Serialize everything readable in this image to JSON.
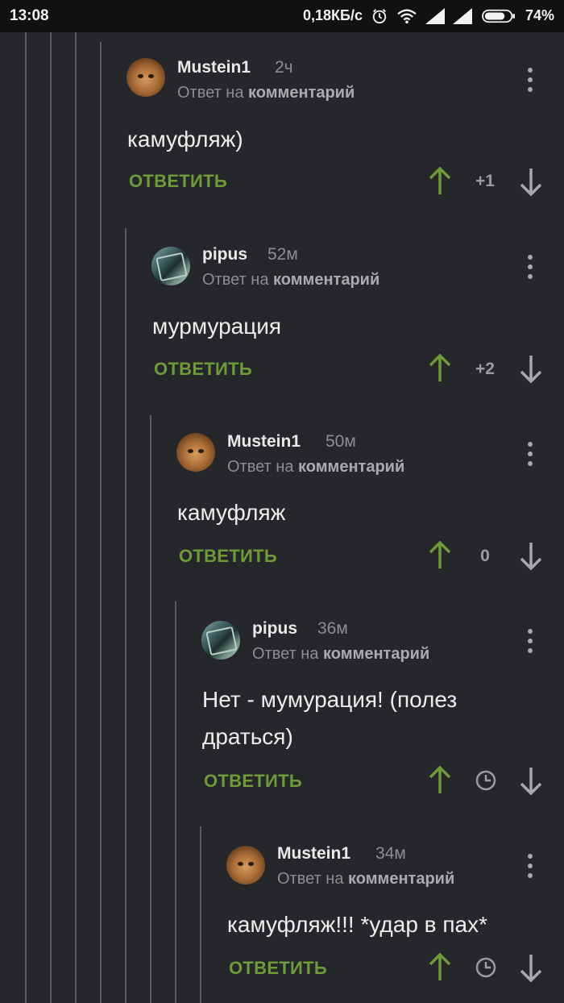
{
  "status_bar": {
    "time": "13:08",
    "network_speed": "0,18КБ/с",
    "battery": "74%",
    "icons": [
      "alarm-icon",
      "wifi-icon",
      "signal-icon",
      "signal-icon",
      "battery-icon"
    ]
  },
  "colors": {
    "background": "#25272b",
    "accent_green": "#6f9a3a",
    "muted_text": "#8b8d90"
  },
  "comments": [
    {
      "author": "Mustein1",
      "time": "2ч",
      "reply_prefix": "Ответ на",
      "reply_target": "комментарий",
      "text_lines": [
        "камуфляж)"
      ],
      "reply_label": "ОТВЕТИТЬ",
      "score": "+1",
      "avatar": "cat-avatar"
    },
    {
      "author": "pipus",
      "time": "52м",
      "reply_prefix": "Ответ на",
      "reply_target": "комментарий",
      "text_lines": [
        "мурмурация"
      ],
      "reply_label": "ОТВЕТИТЬ",
      "score": "+2",
      "avatar": "photo-avatar"
    },
    {
      "author": "Mustein1",
      "time": "50м",
      "reply_prefix": "Ответ на",
      "reply_target": "комментарий",
      "text_lines": [
        "камуфляж"
      ],
      "reply_label": "ОТВЕТИТЬ",
      "score": "0",
      "avatar": "cat-avatar"
    },
    {
      "author": "pipus",
      "time": "36м",
      "reply_prefix": "Ответ на",
      "reply_target": "комментарий",
      "text_lines": [
        "Нет - мумурация! (полез",
        "драться)"
      ],
      "reply_label": "ОТВЕТИТЬ",
      "score_icon": "clock-icon",
      "avatar": "photo-avatar"
    },
    {
      "author": "Mustein1",
      "time": "34м",
      "reply_prefix": "Ответ на",
      "reply_target": "комментарий",
      "text_lines": [
        "камуфляж!!! *удар в пах*"
      ],
      "reply_label": "ОТВЕТИТЬ",
      "score_icon": "clock-icon",
      "avatar": "cat-avatar"
    }
  ]
}
